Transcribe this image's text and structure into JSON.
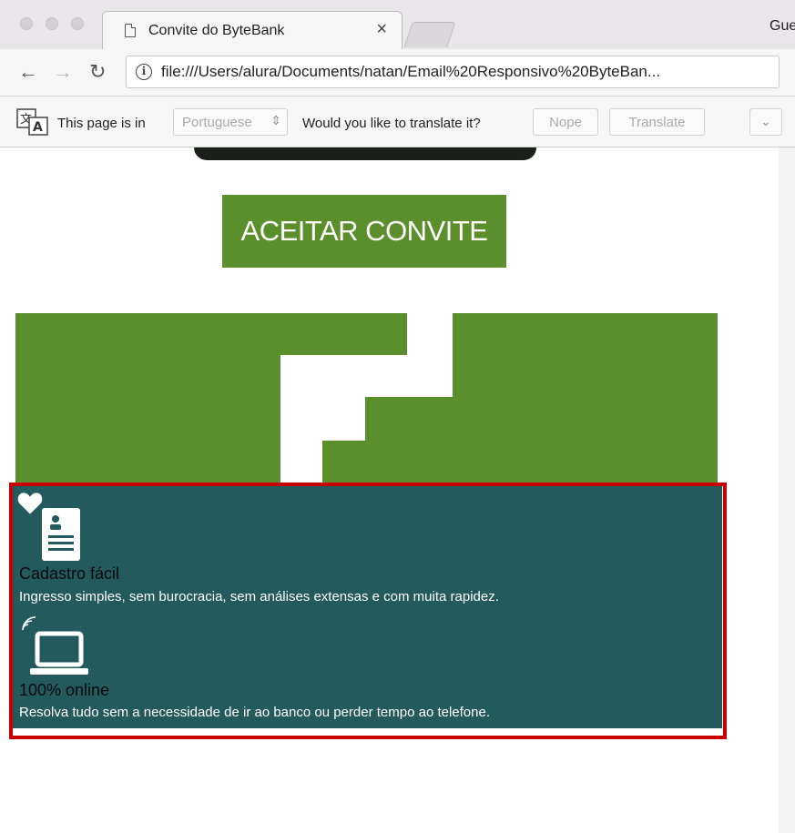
{
  "browser": {
    "tab_title": "Convite do ByteBank",
    "tab_close": "×",
    "profile": "Gue",
    "url": "file:///Users/alura/Documents/natan/Email%20Responsivo%20ByteBan...",
    "translate_bar": {
      "prefix": "This page is in",
      "language": "Portuguese",
      "question": "Would you like to translate it?",
      "nope": "Nope",
      "translate": "Translate"
    }
  },
  "page": {
    "cta_label": "ACEITAR CONVITE",
    "features": [
      {
        "icon": "profile-card-icon",
        "badge_icon": "heart-icon",
        "title": "Cadastro fácil",
        "description": "Ingresso simples, sem burocracia, sem análises extensas e com muita rapidez."
      },
      {
        "icon": "laptop-icon",
        "badge_icon": "wifi-icon",
        "title": "100% online",
        "description": "Resolva tudo sem a necessidade de ir ao banco ou perder tempo ao telefone."
      }
    ]
  },
  "colors": {
    "brand_green": "#5b8f2b",
    "feature_teal": "#225a5e",
    "highlight_red": "#c80000"
  }
}
